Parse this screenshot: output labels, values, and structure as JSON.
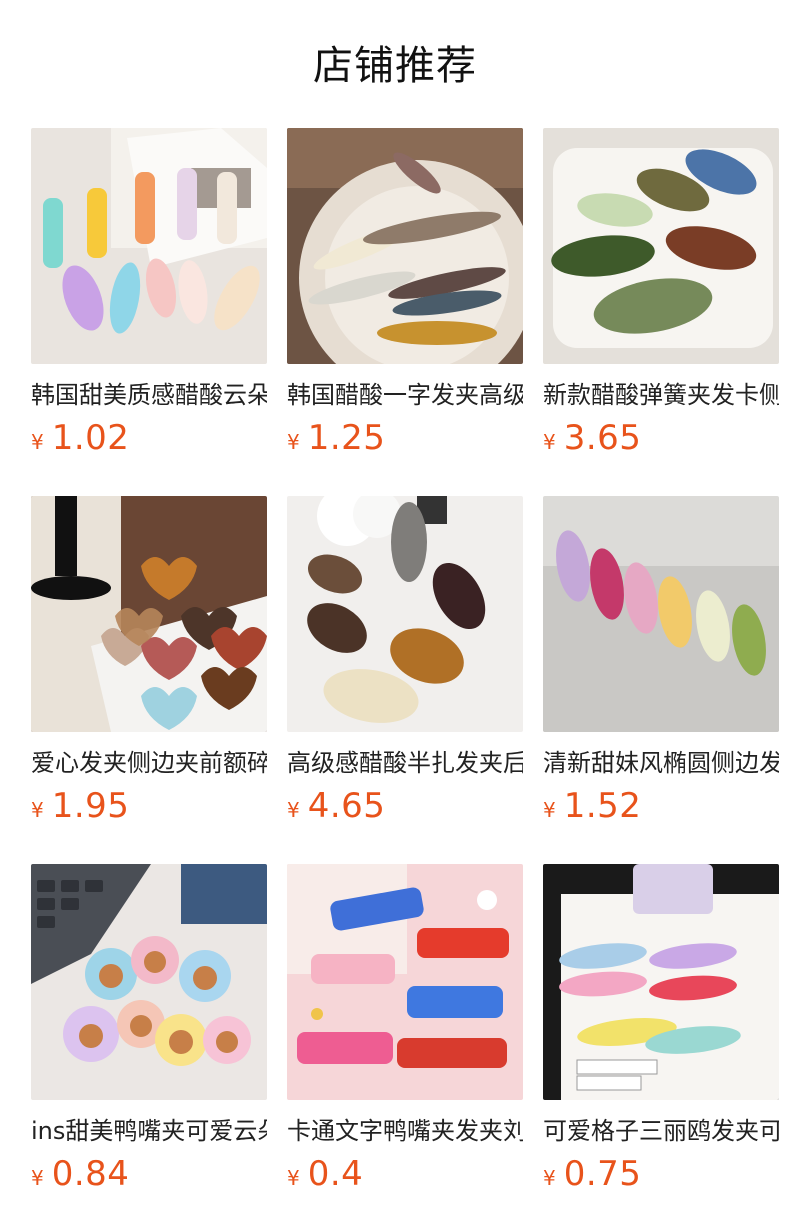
{
  "header": {
    "title": "店铺推荐"
  },
  "currency_symbol": "¥",
  "products": [
    {
      "name": "韩国甜美质感醋酸云朵发夹",
      "price": "1.02",
      "image_icon": "pastel-wavy-clips-image"
    },
    {
      "name": "韩国醋酸一字发夹高级感",
      "price": "1.25",
      "image_icon": "tortoiseshell-clips-plate-image"
    },
    {
      "name": "新款醋酸弹簧夹发卡侧边",
      "price": "3.65",
      "image_icon": "oval-spring-clips-image"
    },
    {
      "name": "爱心发夹侧边夹前额碎发",
      "price": "1.95",
      "image_icon": "heart-clips-image"
    },
    {
      "name": "高级感醋酸半扎发夹后脑",
      "price": "4.65",
      "image_icon": "marble-oval-clips-image"
    },
    {
      "name": "清新甜妹风椭圆侧边发夹",
      "price": "1.52",
      "image_icon": "candy-color-oval-clips-image"
    },
    {
      "name": "ins甜美鸭嘴夹可爱云朵",
      "price": "0.84",
      "image_icon": "cartoon-bear-clips-image"
    },
    {
      "name": "卡通文字鸭嘴夹发夹刘海",
      "price": "0.4",
      "image_icon": "text-slogan-clips-image"
    },
    {
      "name": "可爱格子三丽鸥发夹可爱",
      "price": "0.75",
      "image_icon": "sanrio-gingham-clips-image"
    }
  ]
}
